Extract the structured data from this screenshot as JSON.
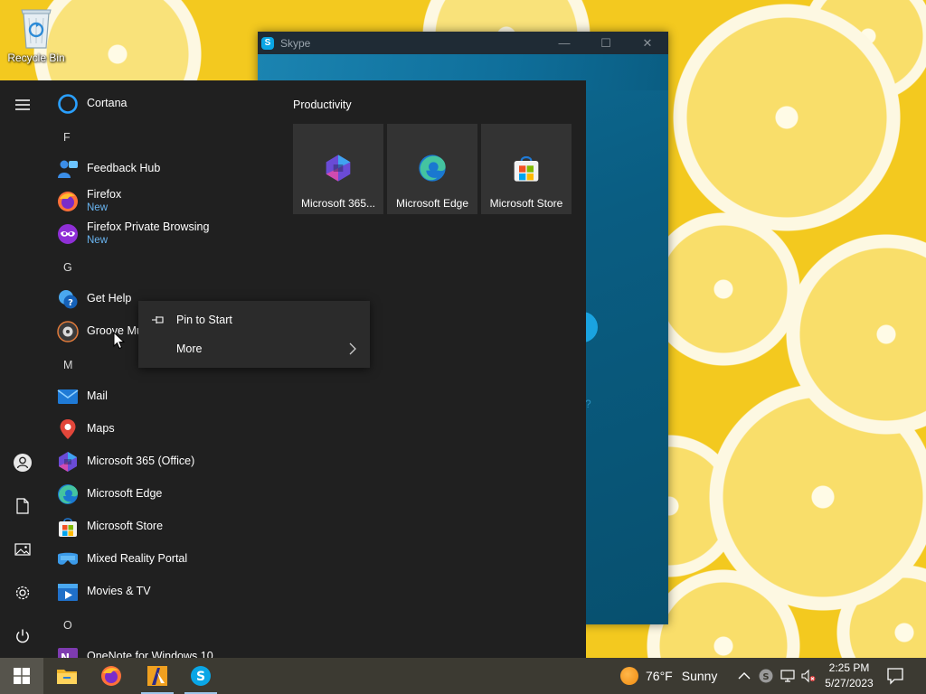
{
  "desktop": {
    "recycle_bin_label": "Recycle Bin"
  },
  "skype_window": {
    "title": "Skype",
    "minimize": "—",
    "maximize": "☐",
    "close": "✕",
    "hint": "?"
  },
  "start_menu": {
    "rail": [
      "menu-icon",
      "user-icon",
      "documents-icon",
      "pictures-icon",
      "settings-icon",
      "power-icon"
    ],
    "app_list": [
      {
        "type": "app",
        "name": "Cortana",
        "icon": "cortana-icon"
      },
      {
        "type": "header",
        "name": "F"
      },
      {
        "type": "app",
        "name": "Feedback Hub",
        "icon": "feedback-hub-icon"
      },
      {
        "type": "app",
        "name": "Firefox",
        "badge": "New",
        "icon": "firefox-icon"
      },
      {
        "type": "app",
        "name": "Firefox Private Browsing",
        "badge": "New",
        "icon": "firefox-private-icon"
      },
      {
        "type": "header",
        "name": "G"
      },
      {
        "type": "app",
        "name": "Get Help",
        "icon": "get-help-icon"
      },
      {
        "type": "app",
        "name": "Groove Mu",
        "icon": "groove-music-icon"
      },
      {
        "type": "header",
        "name": "M"
      },
      {
        "type": "app",
        "name": "Mail",
        "icon": "mail-icon"
      },
      {
        "type": "app",
        "name": "Maps",
        "icon": "maps-icon"
      },
      {
        "type": "app",
        "name": "Microsoft 365 (Office)",
        "icon": "microsoft-365-icon"
      },
      {
        "type": "app",
        "name": "Microsoft Edge",
        "icon": "edge-icon"
      },
      {
        "type": "app",
        "name": "Microsoft Store",
        "icon": "store-icon"
      },
      {
        "type": "app",
        "name": "Mixed Reality Portal",
        "icon": "mixed-reality-icon"
      },
      {
        "type": "app",
        "name": "Movies & TV",
        "icon": "movies-tv-icon"
      },
      {
        "type": "header",
        "name": "O"
      },
      {
        "type": "app",
        "name": "OneNote for Windows 10",
        "icon": "onenote-icon"
      }
    ],
    "tile_group_title": "Productivity",
    "tiles": [
      {
        "label": "Microsoft 365...",
        "icon": "microsoft-365-icon"
      },
      {
        "label": "Microsoft Edge",
        "icon": "edge-icon"
      },
      {
        "label": "Microsoft Store",
        "icon": "store-icon"
      }
    ]
  },
  "context_menu": {
    "items": [
      {
        "label": "Pin to Start",
        "icon": "pin-icon"
      },
      {
        "label": "More",
        "icon": "chevron-right-icon"
      }
    ]
  },
  "taskbar": {
    "apps": [
      "windows-start-icon",
      "file-explorer-icon",
      "firefox-icon",
      "app-icon",
      "skype-icon"
    ],
    "weather": {
      "temperature": "76°F",
      "condition": "Sunny"
    },
    "time": "2:25 PM",
    "date": "5/27/2023",
    "tray": [
      "chevron-up-icon",
      "skype-tray-icon",
      "network-icon",
      "volume-muted-icon",
      "action-center-icon"
    ]
  },
  "colors": {
    "start_bg": "#202020",
    "tile_bg": "#333333",
    "context_bg": "#2b2b2b",
    "badge_blue": "#69b4f0",
    "taskbar_bg": "#3c3a32",
    "skype_blue": "#0a6187"
  }
}
